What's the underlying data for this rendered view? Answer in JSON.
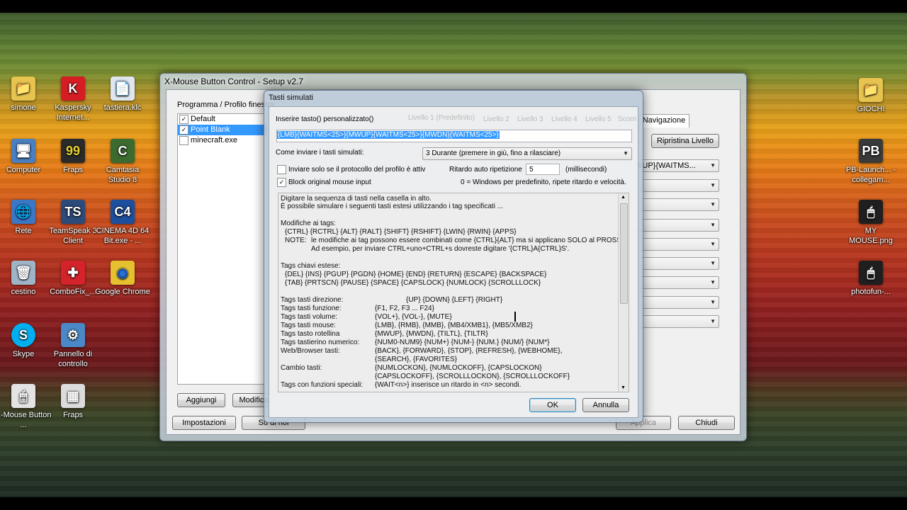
{
  "desktop": {
    "icons": [
      {
        "label": "simone",
        "glyph": "📁",
        "color": "#e7c350"
      },
      {
        "label": "Kaspersky Internet...",
        "glyph": "K",
        "color": "#d71d24"
      },
      {
        "label": "tastiera.klc",
        "glyph": "📄",
        "color": "#dfe6ef"
      },
      {
        "label": "Computer",
        "glyph": "🖥",
        "color": "#4a7fc1"
      },
      {
        "label": "Fraps",
        "glyph": "99",
        "color": "#2a2a2a"
      },
      {
        "label": "Camtasia Studio 8",
        "glyph": "C",
        "color": "#3c6b2f"
      },
      {
        "label": "Rete",
        "glyph": "🌐",
        "color": "#3a78c7"
      },
      {
        "label": "TeamSpeak 3 Client",
        "glyph": "TS",
        "color": "#2c4a7a"
      },
      {
        "label": "CINEMA 4D 64 Bit.exe - ...",
        "glyph": "C4",
        "color": "#1c4f9e"
      },
      {
        "label": "cestino",
        "glyph": "🗑",
        "color": "#9fb4c7"
      },
      {
        "label": "ComboFix_...",
        "glyph": "✚",
        "color": "#d4232a"
      },
      {
        "label": "Google Chrome",
        "glyph": "◉",
        "color": "#e6c12f"
      },
      {
        "label": "Skype",
        "glyph": "S",
        "color": "#00aff0"
      },
      {
        "label": "Pannello di controllo",
        "glyph": "⚙",
        "color": "#4b88c8"
      },
      {
        "label": "X-Mouse Button ...",
        "glyph": "🖱",
        "color": "#e4e4e4"
      },
      {
        "label": "Fraps",
        "glyph": "▦",
        "color": "#dcdcdc"
      },
      {
        "label": "GIOCHI",
        "glyph": "📁",
        "color": "#e7c350"
      },
      {
        "label": "PB-Launch... - collegam...",
        "glyph": "PB",
        "color": "#3a3a3a"
      },
      {
        "label": "MY MOUSE.png",
        "glyph": "🖱",
        "color": "#1f1f1f"
      },
      {
        "label": "photofun-...",
        "glyph": "🖱",
        "color": "#1f1f1f"
      }
    ]
  },
  "main_window": {
    "title": "X-Mouse Button Control - Setup v2.7",
    "profile_header": "Programma / Profilo finestra",
    "profiles": [
      {
        "name": "Default",
        "checked": "✓"
      },
      {
        "name": "Point Blank",
        "checked": "✓"
      },
      {
        "name": "minecraft.exe",
        "checked": ""
      }
    ],
    "tab_navigazione": "Navigazione",
    "ripristina": "Ripristina Livello",
    "mapping_combo_text": "WUP}{WAITMS...",
    "aggiungi": "Aggiungi",
    "modifica": "Modifica",
    "impostazioni": "Impostazioni",
    "su_di_noi": "Su di noi",
    "applica": "Applica",
    "chiudi": "Chiudi"
  },
  "dialog": {
    "title": "Tasti simulati",
    "custom_label": "Inserire tasto() personalizzato()",
    "custom_value": "{LMB}{WAITMS<25>}{MWUP}{WAITMS<25>}{MWDN}{WAITMS<25>}",
    "send_label": "Come inviare i tasti simulati:",
    "send_value": "3 Durante (premere in giù, fino a rilasciare)",
    "only_protocol_label": "Inviare solo se il protocollo del profilo è attiv",
    "block_label": "Block original mouse input",
    "repeat_label": "Ritardo auto ripetizione",
    "repeat_value": "5",
    "ms_label": "(millisecondi)",
    "repeat_note": "0 = Windows per predefinito, ripete ritardo e velocità.",
    "ok": "OK",
    "annulla": "Annulla",
    "ghost_tabs": [
      "Livello 1 (Predefinito)",
      "Livello 2",
      "Livello 3",
      "Livello 4",
      "Livello 5",
      "Scorri"
    ],
    "help": {
      "intro1": "Digitare la sequenza di tasti nella casella in alto.",
      "intro2": " È possibile simulare i seguenti tasti estesi utilizzando i tag specificati ...",
      "mod_title": "Modifiche ai tags:",
      "mod_tags": "{CTRL} {RCTRL} {ALT} {RALT} {SHIFT} {RSHIFT} {LWIN} {RWIN} {APPS}",
      "note_label": "NOTE:",
      "note1": "le modifiche ai tag possono essere combinati come {CTRL}{ALT} ma si applicano SOLO al PROSSIMO",
      "note2": "Ad esempio, per inviare CTRL+uno+CTRL+s dovreste digitare '{CTRL}A{CTRL}S'.",
      "ext_title": "Tags chiavi estese:",
      "ext1": "{DEL} {INS} {PGUP} {PGDN} {HOME} {END} {RETURN} {ESCAPE} {BACKSPACE}",
      "ext2": "{TAB} {PRTSCN} {PAUSE} {SPACE} {CAPSLOCK} {NUMLOCK} {SCROLLLOCK}",
      "rows": [
        {
          "k": "Tags tasti direzione:",
          "v": "{UP} {DOWN} {LEFT} {RIGHT}"
        },
        {
          "k": "Tags tasti funzione:",
          "v": "{F1, F2, F3 ... F24}"
        },
        {
          "k": "Tags tasti volume:",
          "v": "{VOL+}, {VOL-}, {MUTE}"
        },
        {
          "k": "Tags tasti mouse:",
          "v": "{LMB}, {RMB}, {MMB}, {MB4/XMB1}, {MB5/XMB2}"
        },
        {
          "k": "Tags tasto rotellina",
          "v": "{MWUP}, {MWDN}, {TILTL}, {TILTR}"
        },
        {
          "k": "Tags tastierino numerico:",
          "v": "{NUM0-NUM9} {NUM+} {NUM-} {NUM.} {NUM/} {NUM*}"
        },
        {
          "k": "Web/Browser tasti:",
          "v": "{BACK}, {FORWARD}, {STOP}, {REFRESH}, {WEBHOME},"
        },
        {
          "k": "",
          "v": "{SEARCH}, {FAVORITES}"
        },
        {
          "k": "Cambio tasti:",
          "v": "{NUMLOCKON}, {NUMLOCKOFF}, {CAPSLOCKON}"
        },
        {
          "k": "",
          "v": "{CAPSLOCKOFF}, {SCROLLLOCKON}, {SCROLLLOCKOFF}"
        },
        {
          "k": "Tags con funzioni speciali:",
          "v": "{WAIT<n>}  inserisce un ritardo in <n> secondi."
        }
      ]
    }
  }
}
